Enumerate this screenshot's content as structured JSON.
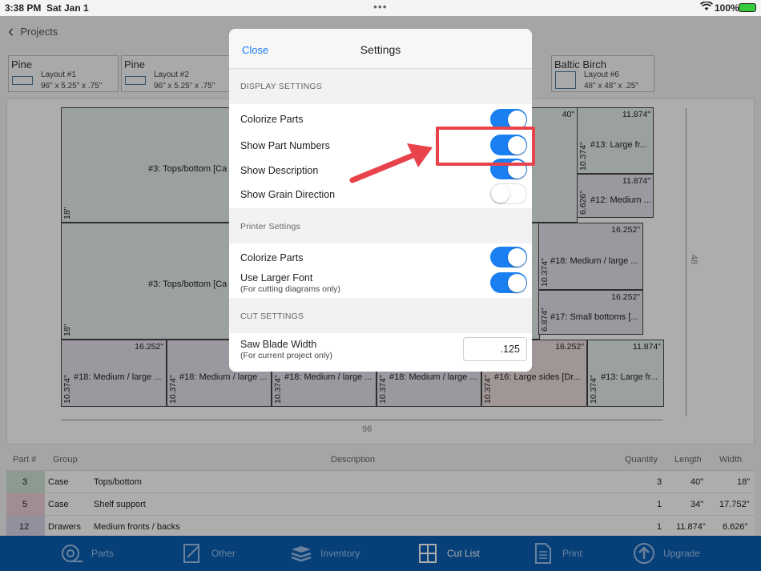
{
  "status_bar": {
    "time": "3:38 PM",
    "date": "Sat Jan 1",
    "battery": "100%"
  },
  "nav": {
    "back_label": "Projects"
  },
  "layouts": [
    {
      "material": "Pine",
      "name": "Layout #1",
      "dims": "96\" x 5.25\" x .75\""
    },
    {
      "material": "Pine",
      "name": "Layout #2",
      "dims": "96\" x 5.25\" x .75\""
    },
    {
      "material": "Baltic Birch",
      "name": "Layout #6",
      "dims": "48\" x 48\" x .25\""
    }
  ],
  "diagram": {
    "overall_width": "96",
    "overall_height": "48",
    "parts": [
      {
        "label": "#3: Tops/bottom [Ca",
        "width": "40\"",
        "height": "18\""
      },
      {
        "label": "#3: Tops/bottom [Ca",
        "height": "18\""
      },
      {
        "label": "#13: Large fr...",
        "width": "11.874\"",
        "height": "10.374\""
      },
      {
        "label": "#12: Medium ...",
        "width": "11.874\"",
        "height": "6.626\""
      },
      {
        "label": "#18: Medium / large ...",
        "width": "16.252\"",
        "height": "10.374\""
      },
      {
        "label": "#17: Small bottoms [...",
        "width": "16.252\"",
        "height": "6.874\""
      },
      {
        "label": "#18: Medium / large ...",
        "width": "16.252\"",
        "height": "10.374\""
      },
      {
        "label": "#18: Medium / large ...",
        "height": "10.374\""
      },
      {
        "label": "#18: Medium / large ...",
        "height": "10.374\""
      },
      {
        "label": "#18: Medium / large ...",
        "height": "10.374\""
      },
      {
        "label": "#16: Large sides [Dr...",
        "width": "16.252\"",
        "height": "10.374\""
      },
      {
        "label": "#13: Large fr...",
        "width": "11.874\"",
        "height": "10.374\""
      }
    ]
  },
  "table": {
    "headers": {
      "part": "Part #",
      "group": "Group",
      "description": "Description",
      "quantity": "Quantity",
      "length": "Length",
      "width": "Width"
    },
    "rows": [
      {
        "part": "3",
        "group": "Case",
        "description": "Tops/bottom",
        "quantity": "3",
        "length": "40\"",
        "width": "18\"",
        "color": "#cfe3d8"
      },
      {
        "part": "5",
        "group": "Case",
        "description": "Shelf support",
        "quantity": "1",
        "length": "34\"",
        "width": "17.752\"",
        "color": "#ecd0d6"
      },
      {
        "part": "12",
        "group": "Drawers",
        "description": "Medium fronts / backs",
        "quantity": "1",
        "length": "11.874\"",
        "width": "6.626\"",
        "color": "#d9d3e6"
      }
    ]
  },
  "tabbar": [
    {
      "label": "Parts",
      "icon": "tape-measure-icon"
    },
    {
      "label": "Other",
      "icon": "edit-icon"
    },
    {
      "label": "Inventory",
      "icon": "stack-icon"
    },
    {
      "label": "Cut List",
      "icon": "cut-list-icon",
      "active": true
    },
    {
      "label": "Print",
      "icon": "print-icon"
    },
    {
      "label": "Upgrade",
      "icon": "upgrade-icon"
    }
  ],
  "settings": {
    "close_label": "Close",
    "title": "Settings",
    "display_header": "DISPLAY SETTINGS",
    "display": [
      {
        "label": "Colorize Parts",
        "on": true
      },
      {
        "label": "Show Part Numbers",
        "on": true
      },
      {
        "label": "Show Description",
        "on": true
      },
      {
        "label": "Show Grain Direction",
        "on": false
      }
    ],
    "printer_header": "Printer Settings",
    "printer": [
      {
        "label": "Colorize Parts",
        "on": true
      },
      {
        "label": "Use Larger Font",
        "sub": "(For cutting diagrams only)",
        "on": true
      }
    ],
    "cut_header": "CUT SETTINGS",
    "saw_blade": {
      "label": "Saw Blade Width",
      "sub": "(For current project only)",
      "value": ".125"
    }
  },
  "colors": {
    "accent": "#1a7ff0",
    "tabbar": "#0b5fb3",
    "annotation": "#e8424a"
  }
}
